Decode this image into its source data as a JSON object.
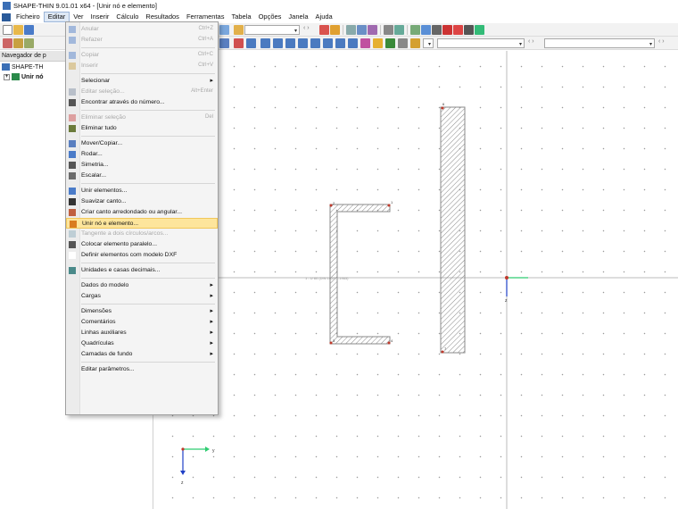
{
  "window": {
    "title": "SHAPE-THIN 9.01.01 x64 - [Unir nó e elemento]"
  },
  "menubar": {
    "items": [
      {
        "id": "ficheiro",
        "label": "Ficheiro"
      },
      {
        "id": "editar",
        "label": "Editar"
      },
      {
        "id": "ver",
        "label": "Ver"
      },
      {
        "id": "inserir",
        "label": "Inserir"
      },
      {
        "id": "calculo",
        "label": "Cálculo"
      },
      {
        "id": "resultados",
        "label": "Resultados"
      },
      {
        "id": "ferramentas",
        "label": "Ferramentas"
      },
      {
        "id": "tabela",
        "label": "Tabela"
      },
      {
        "id": "opcoes",
        "label": "Opções"
      },
      {
        "id": "janela",
        "label": "Janela"
      },
      {
        "id": "ajuda",
        "label": "Ajuda"
      }
    ]
  },
  "navigator": {
    "header": "Navegador de p",
    "root": "SHAPE-TH",
    "child": "Unir nó"
  },
  "edit_menu": {
    "items": [
      {
        "label": "Anular",
        "shortcut": "Ctrl+Z",
        "disabled": true
      },
      {
        "label": "Refazer",
        "shortcut": "Ctrl+A",
        "disabled": true
      },
      {
        "sep": true
      },
      {
        "label": "Copiar",
        "shortcut": "Ctrl+C",
        "disabled": true
      },
      {
        "label": "Inserir",
        "shortcut": "Ctrl+V",
        "disabled": true
      },
      {
        "sep": true
      },
      {
        "label": "Selecionar",
        "submenu": true
      },
      {
        "label": "Editar seleção...",
        "shortcut": "Alt+Enter",
        "disabled": true
      },
      {
        "label": "Encontrar através do número..."
      },
      {
        "sep": true
      },
      {
        "label": "Eliminar seleção",
        "shortcut": "Del",
        "disabled": true
      },
      {
        "label": "Eliminar tudo"
      },
      {
        "sep": true
      },
      {
        "label": "Mover/Copiar..."
      },
      {
        "label": "Rodar..."
      },
      {
        "label": "Simetria..."
      },
      {
        "label": "Escalar..."
      },
      {
        "sep": true
      },
      {
        "label": "Unir elementos..."
      },
      {
        "label": "Suavizar canto..."
      },
      {
        "label": "Criar canto arredondado ou angular..."
      },
      {
        "label": "Unir nó e elemento...",
        "highlight": true
      },
      {
        "label": "Tangente a dois círculos/arcos...",
        "disabled": true
      },
      {
        "label": "Colocar elemento paralelo..."
      },
      {
        "label": "Definir elementos com modelo DXF"
      },
      {
        "sep": true
      },
      {
        "label": "Unidades e casas decimais..."
      },
      {
        "sep": true
      },
      {
        "label": "Dados do modelo",
        "submenu": true
      },
      {
        "label": "Cargas",
        "submenu": true
      },
      {
        "sep": true
      },
      {
        "label": "Dimensões",
        "submenu": true
      },
      {
        "label": "Comentários",
        "submenu": true
      },
      {
        "label": "Linhas auxiliares",
        "submenu": true
      },
      {
        "label": "Quadrículas",
        "submenu": true
      },
      {
        "label": "Camadas de fundo",
        "submenu": true
      },
      {
        "sep": true
      },
      {
        "label": "Editar parâmetros..."
      }
    ]
  },
  "canvas": {
    "axis_y": "y",
    "axis_z": "z",
    "section_label": "1 - U 80 (DIN 1026-1:1963)",
    "node_labels": [
      "1",
      "2",
      "3",
      "4",
      "6",
      "7"
    ],
    "colors": {
      "hatch": "#888888",
      "node": "#c0392b",
      "axis_y": "#2ecc71",
      "axis_z": "#1f3fc6",
      "section_line": "#bbbbbb"
    }
  }
}
